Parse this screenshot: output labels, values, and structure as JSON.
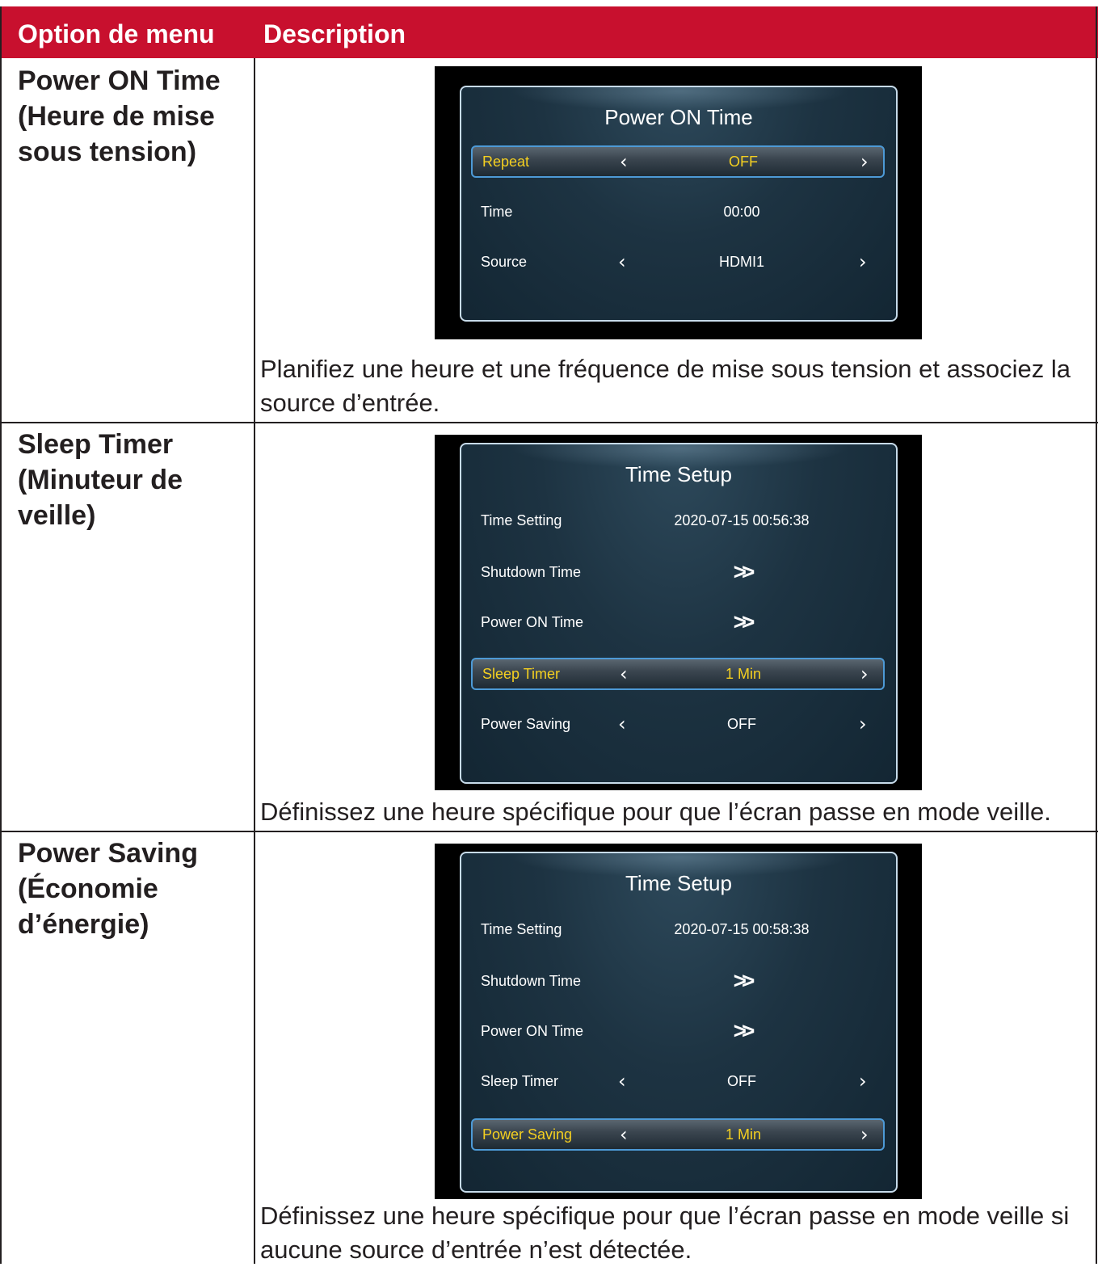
{
  "header": {
    "col1": "Option de menu",
    "col2": "Description"
  },
  "rows": [
    {
      "option": "Power ON Time\n(Heure de mise sous tension)",
      "option_lines": [
        "Power ON Time",
        "(Heure de mise",
        "sous tension)"
      ],
      "description_lines": [
        "Planifiez une heure et une fréquence de mise sous tension et associez la",
        "source d’entrée."
      ],
      "osd": {
        "title": "Power ON Time",
        "items": [
          {
            "label": "Repeat",
            "value": "OFF",
            "arrows": true,
            "selected": true
          },
          {
            "label": "Time",
            "value": "00:00",
            "arrows": false,
            "selected": false
          },
          {
            "label": "Source",
            "value": "HDMI1",
            "arrows": true,
            "selected": false
          }
        ]
      }
    },
    {
      "option_lines": [
        "Sleep Timer",
        "(Minuteur de",
        "veille)"
      ],
      "description_lines": [
        "Définissez une heure spécifique pour que l’écran passe en mode veille."
      ],
      "osd": {
        "title": "Time Setup",
        "items": [
          {
            "label": "Time Setting",
            "value": "2020-07-15 00:56:38"
          },
          {
            "label": "Shutdown Time",
            "value": ">>"
          },
          {
            "label": "Power ON Time",
            "value": ">>"
          },
          {
            "label": "Sleep Timer",
            "value": "1 Min",
            "arrows": true,
            "selected": true
          },
          {
            "label": "Power Saving",
            "value": "OFF",
            "arrows": true
          }
        ]
      }
    },
    {
      "option_lines": [
        "Power Saving",
        "(Économie",
        "d’énergie)"
      ],
      "description_lines": [
        "Définissez une heure spécifique pour que l’écran passe en mode veille si",
        "aucune source d’entrée n’est détectée."
      ],
      "osd": {
        "title": "Time Setup",
        "items": [
          {
            "label": "Time Setting",
            "value": "2020-07-15 00:58:38"
          },
          {
            "label": "Shutdown Time",
            "value": ">>"
          },
          {
            "label": "Power ON Time",
            "value": ">>"
          },
          {
            "label": "Sleep Timer",
            "value": "OFF",
            "arrows": true
          },
          {
            "label": "Power Saving",
            "value": "1 Min",
            "arrows": true,
            "selected": true
          }
        ]
      }
    }
  ],
  "arrows": {
    "left": "‹",
    "right": "›"
  },
  "colors": {
    "header_bg": "#c8102e",
    "selected_text": "#f5d020"
  }
}
